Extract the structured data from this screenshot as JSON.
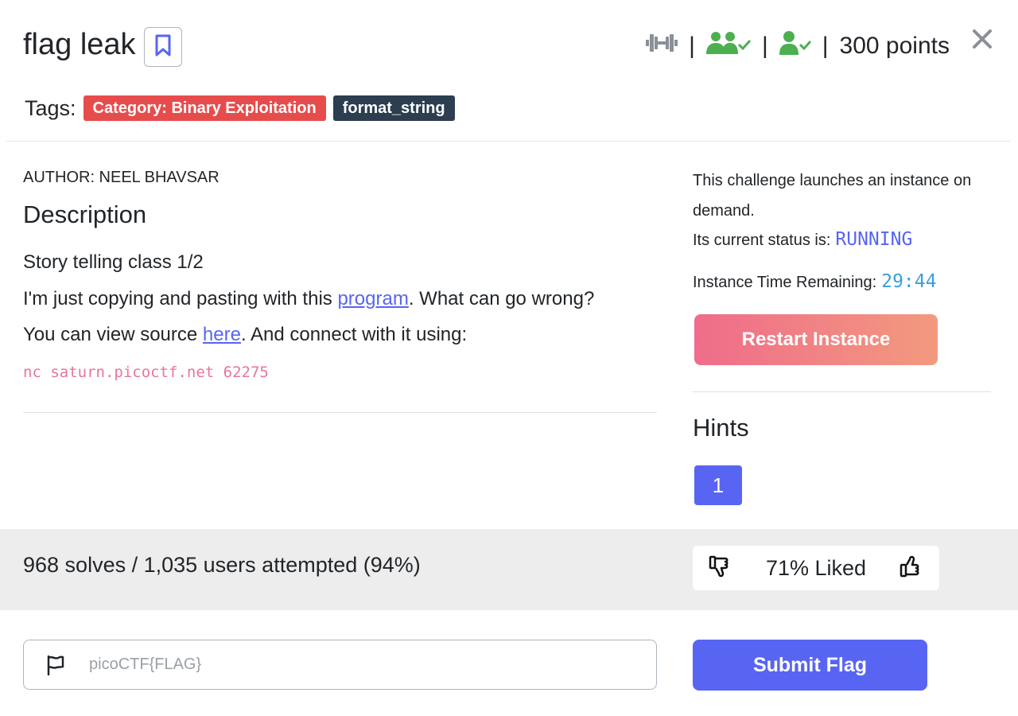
{
  "challenge": {
    "title": "flag leak",
    "points": "300 points",
    "tags_label": "Tags:",
    "tags": [
      "Category: Binary Exploitation",
      "format_string"
    ]
  },
  "description": {
    "author": "AUTHOR: NEEL BHAVSAR",
    "heading": "Description",
    "line1": "Story telling class 1/2",
    "line2_prefix": "I'm just copying and pasting with this ",
    "line2_link": "program",
    "line2_suffix": ". What can go wrong?",
    "line3_prefix": "You can view source ",
    "line3_link": "here",
    "line3_suffix": ". And connect with it using:",
    "command": "nc saturn.picoctf.net 62275"
  },
  "instance": {
    "info": "This challenge launches an instance on demand.",
    "status_label": "Its current status is:",
    "status_value": "RUNNING",
    "timer_label": "Instance Time Remaining:",
    "timer_value": "29:44",
    "restart_label": "Restart Instance"
  },
  "hints": {
    "heading": "Hints",
    "items": [
      "1"
    ]
  },
  "stats": {
    "solves_text": "968 solves / 1,035 users attempted (94%)",
    "liked_text": "71% Liked"
  },
  "flag": {
    "placeholder": "picoCTF{FLAG}",
    "value": "",
    "submit_label": "Submit Flag"
  },
  "colors": {
    "accent": "#5865f2",
    "difficulty_icon": "#8a8f98",
    "solved_icon": "#4caf50",
    "category_badge": "#e74c4c",
    "tag_badge": "#2c3e50",
    "command_text": "#e8759a"
  },
  "icons": [
    "bookmark-icon",
    "dumbbell-icon",
    "users-check-icon",
    "user-check-icon",
    "close-icon",
    "thumbs-down-icon",
    "thumbs-up-icon",
    "flag-icon"
  ]
}
